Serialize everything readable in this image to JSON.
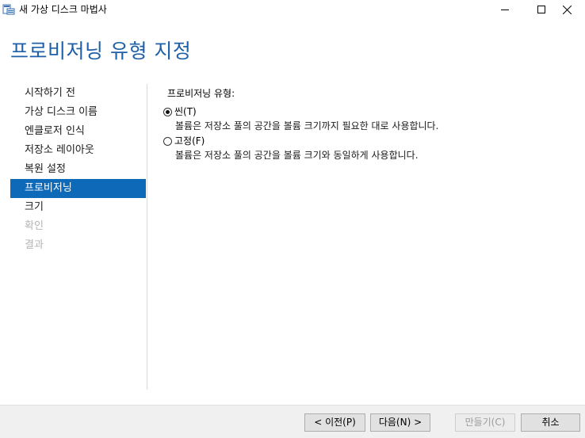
{
  "window": {
    "title": "새 가상 디스크 마법사",
    "icon": "virtual-disk-icon",
    "controls": [
      "minimize-icon",
      "maximize-icon",
      "close-icon"
    ]
  },
  "wizard": {
    "title": "프로비저닝 유형 지정"
  },
  "steps": [
    {
      "label": "시작하기 전",
      "state": "normal"
    },
    {
      "label": "가상 디스크 이름",
      "state": "normal"
    },
    {
      "label": "엔클로저 인식",
      "state": "normal"
    },
    {
      "label": "저장소 레이아웃",
      "state": "normal"
    },
    {
      "label": "복원 설정",
      "state": "normal"
    },
    {
      "label": "프로비저닝",
      "state": "active"
    },
    {
      "label": "크기",
      "state": "normal"
    },
    {
      "label": "확인",
      "state": "disabled"
    },
    {
      "label": "결과",
      "state": "disabled"
    }
  ],
  "provisioning": {
    "label": "프로비저닝 유형:",
    "options": [
      {
        "label": "씬(T)",
        "description": "볼륨은 저장소 풀의 공간을 볼륨 크기까지 필요한 대로 사용합니다.",
        "selected": true
      },
      {
        "label": "고정(F)",
        "description": "볼륨은 저장소 풀의 공간을 볼륨 크기와 동일하게 사용합니다.",
        "selected": false
      }
    ]
  },
  "buttons": {
    "prev": "< 이전(P)",
    "next": "다음(N) >",
    "create": "만들기(C)",
    "cancel": "취소"
  },
  "colors": {
    "accent": "#0e6ab8",
    "title": "#1f5fa8",
    "disabled_text": "#b4b4b4"
  }
}
